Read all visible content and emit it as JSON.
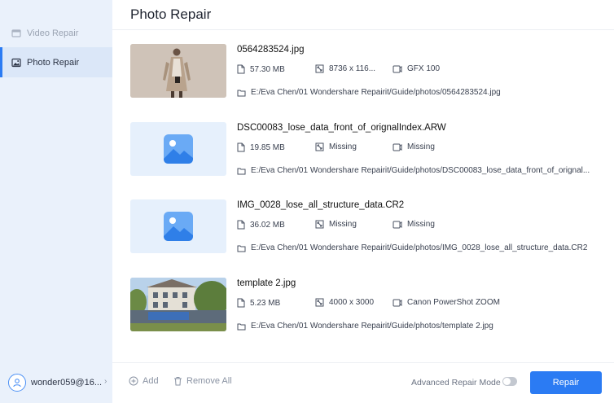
{
  "sidebar": {
    "items": [
      {
        "label": "Video Repair",
        "icon": "video-icon",
        "active": false
      },
      {
        "label": "Photo Repair",
        "icon": "photo-icon",
        "active": true
      }
    ],
    "account": {
      "label": "wonder059@16...",
      "icon": "user-icon"
    }
  },
  "main": {
    "title": "Photo Repair",
    "files": [
      {
        "name": "0564283524.jpg",
        "size": "57.30  MB",
        "resolution": "8736 x 116...",
        "camera": "GFX 100",
        "path": "E:/Eva Chen/01 Wondershare Repairit/Guide/photos/0564283524.jpg",
        "thumb": "woman-photo"
      },
      {
        "name": "DSC00083_lose_data_front_of_orignalIndex.ARW",
        "size": "19.85  MB",
        "resolution": "Missing",
        "camera": "Missing",
        "path": "E:/Eva Chen/01 Wondershare Repairit/Guide/photos/DSC00083_lose_data_front_of_orignal...",
        "thumb": "image-placeholder-icon"
      },
      {
        "name": "IMG_0028_lose_all_structure_data.CR2",
        "size": "36.02  MB",
        "resolution": "Missing",
        "camera": "Missing",
        "path": "E:/Eva Chen/01 Wondershare Repairit/Guide/photos/IMG_0028_lose_all_structure_data.CR2",
        "thumb": "image-placeholder-icon"
      },
      {
        "name": "template 2.jpg",
        "size": "5.23  MB",
        "resolution": "4000 x 3000",
        "camera": "Canon PowerShot ZOOM",
        "path": "E:/Eva Chen/01 Wondershare Repairit/Guide/photos/template 2.jpg",
        "thumb": "building-photo"
      }
    ]
  },
  "footer": {
    "add_label": "Add",
    "remove_all_label": "Remove All",
    "advanced_mode_label": "Advanced Repair Mode",
    "advanced_mode_on": false,
    "repair_label": "Repair"
  },
  "colors": {
    "accent": "#2b7bf3",
    "sidebar_bg": "#eaf1fb",
    "placeholder_bg": "#e6f0fc"
  }
}
